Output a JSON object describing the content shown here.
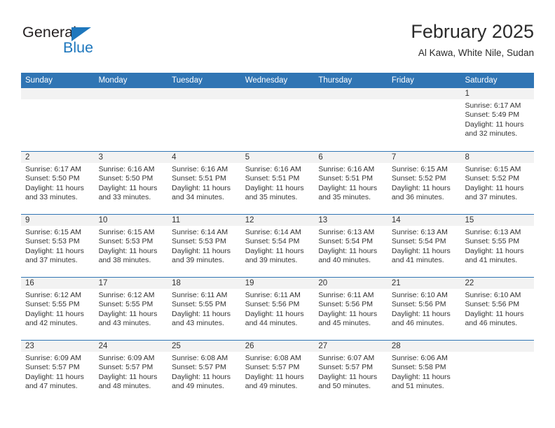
{
  "logo": {
    "word_one": "General",
    "word_two": "Blue",
    "triangle_color": "#1e77bd"
  },
  "header": {
    "title": "February 2025",
    "subtitle": "Al Kawa, White Nile, Sudan"
  },
  "theme": {
    "header_blue": "#3075b4",
    "day_band_gray": "#f2f2f2",
    "text": "#333333"
  },
  "weekdays": [
    "Sunday",
    "Monday",
    "Tuesday",
    "Wednesday",
    "Thursday",
    "Friday",
    "Saturday"
  ],
  "labels": {
    "sunrise_prefix": "Sunrise:",
    "sunset_prefix": "Sunset:",
    "daylight_prefix": "Daylight:"
  },
  "weeks": [
    [
      {
        "day": "",
        "sunrise": "",
        "sunset": "",
        "daylight": "",
        "empty": true
      },
      {
        "day": "",
        "sunrise": "",
        "sunset": "",
        "daylight": "",
        "empty": true
      },
      {
        "day": "",
        "sunrise": "",
        "sunset": "",
        "daylight": "",
        "empty": true
      },
      {
        "day": "",
        "sunrise": "",
        "sunset": "",
        "daylight": "",
        "empty": true
      },
      {
        "day": "",
        "sunrise": "",
        "sunset": "",
        "daylight": "",
        "empty": true
      },
      {
        "day": "",
        "sunrise": "",
        "sunset": "",
        "daylight": "",
        "empty": true
      },
      {
        "day": "1",
        "sunrise": "Sunrise: 6:17 AM",
        "sunset": "Sunset: 5:49 PM",
        "daylight": "Daylight: 11 hours and 32 minutes.",
        "empty": false
      }
    ],
    [
      {
        "day": "2",
        "sunrise": "Sunrise: 6:17 AM",
        "sunset": "Sunset: 5:50 PM",
        "daylight": "Daylight: 11 hours and 33 minutes.",
        "empty": false
      },
      {
        "day": "3",
        "sunrise": "Sunrise: 6:16 AM",
        "sunset": "Sunset: 5:50 PM",
        "daylight": "Daylight: 11 hours and 33 minutes.",
        "empty": false
      },
      {
        "day": "4",
        "sunrise": "Sunrise: 6:16 AM",
        "sunset": "Sunset: 5:51 PM",
        "daylight": "Daylight: 11 hours and 34 minutes.",
        "empty": false
      },
      {
        "day": "5",
        "sunrise": "Sunrise: 6:16 AM",
        "sunset": "Sunset: 5:51 PM",
        "daylight": "Daylight: 11 hours and 35 minutes.",
        "empty": false
      },
      {
        "day": "6",
        "sunrise": "Sunrise: 6:16 AM",
        "sunset": "Sunset: 5:51 PM",
        "daylight": "Daylight: 11 hours and 35 minutes.",
        "empty": false
      },
      {
        "day": "7",
        "sunrise": "Sunrise: 6:15 AM",
        "sunset": "Sunset: 5:52 PM",
        "daylight": "Daylight: 11 hours and 36 minutes.",
        "empty": false
      },
      {
        "day": "8",
        "sunrise": "Sunrise: 6:15 AM",
        "sunset": "Sunset: 5:52 PM",
        "daylight": "Daylight: 11 hours and 37 minutes.",
        "empty": false
      }
    ],
    [
      {
        "day": "9",
        "sunrise": "Sunrise: 6:15 AM",
        "sunset": "Sunset: 5:53 PM",
        "daylight": "Daylight: 11 hours and 37 minutes.",
        "empty": false
      },
      {
        "day": "10",
        "sunrise": "Sunrise: 6:15 AM",
        "sunset": "Sunset: 5:53 PM",
        "daylight": "Daylight: 11 hours and 38 minutes.",
        "empty": false
      },
      {
        "day": "11",
        "sunrise": "Sunrise: 6:14 AM",
        "sunset": "Sunset: 5:53 PM",
        "daylight": "Daylight: 11 hours and 39 minutes.",
        "empty": false
      },
      {
        "day": "12",
        "sunrise": "Sunrise: 6:14 AM",
        "sunset": "Sunset: 5:54 PM",
        "daylight": "Daylight: 11 hours and 39 minutes.",
        "empty": false
      },
      {
        "day": "13",
        "sunrise": "Sunrise: 6:13 AM",
        "sunset": "Sunset: 5:54 PM",
        "daylight": "Daylight: 11 hours and 40 minutes.",
        "empty": false
      },
      {
        "day": "14",
        "sunrise": "Sunrise: 6:13 AM",
        "sunset": "Sunset: 5:54 PM",
        "daylight": "Daylight: 11 hours and 41 minutes.",
        "empty": false
      },
      {
        "day": "15",
        "sunrise": "Sunrise: 6:13 AM",
        "sunset": "Sunset: 5:55 PM",
        "daylight": "Daylight: 11 hours and 41 minutes.",
        "empty": false
      }
    ],
    [
      {
        "day": "16",
        "sunrise": "Sunrise: 6:12 AM",
        "sunset": "Sunset: 5:55 PM",
        "daylight": "Daylight: 11 hours and 42 minutes.",
        "empty": false
      },
      {
        "day": "17",
        "sunrise": "Sunrise: 6:12 AM",
        "sunset": "Sunset: 5:55 PM",
        "daylight": "Daylight: 11 hours and 43 minutes.",
        "empty": false
      },
      {
        "day": "18",
        "sunrise": "Sunrise: 6:11 AM",
        "sunset": "Sunset: 5:55 PM",
        "daylight": "Daylight: 11 hours and 43 minutes.",
        "empty": false
      },
      {
        "day": "19",
        "sunrise": "Sunrise: 6:11 AM",
        "sunset": "Sunset: 5:56 PM",
        "daylight": "Daylight: 11 hours and 44 minutes.",
        "empty": false
      },
      {
        "day": "20",
        "sunrise": "Sunrise: 6:11 AM",
        "sunset": "Sunset: 5:56 PM",
        "daylight": "Daylight: 11 hours and 45 minutes.",
        "empty": false
      },
      {
        "day": "21",
        "sunrise": "Sunrise: 6:10 AM",
        "sunset": "Sunset: 5:56 PM",
        "daylight": "Daylight: 11 hours and 46 minutes.",
        "empty": false
      },
      {
        "day": "22",
        "sunrise": "Sunrise: 6:10 AM",
        "sunset": "Sunset: 5:56 PM",
        "daylight": "Daylight: 11 hours and 46 minutes.",
        "empty": false
      }
    ],
    [
      {
        "day": "23",
        "sunrise": "Sunrise: 6:09 AM",
        "sunset": "Sunset: 5:57 PM",
        "daylight": "Daylight: 11 hours and 47 minutes.",
        "empty": false
      },
      {
        "day": "24",
        "sunrise": "Sunrise: 6:09 AM",
        "sunset": "Sunset: 5:57 PM",
        "daylight": "Daylight: 11 hours and 48 minutes.",
        "empty": false
      },
      {
        "day": "25",
        "sunrise": "Sunrise: 6:08 AM",
        "sunset": "Sunset: 5:57 PM",
        "daylight": "Daylight: 11 hours and 49 minutes.",
        "empty": false
      },
      {
        "day": "26",
        "sunrise": "Sunrise: 6:08 AM",
        "sunset": "Sunset: 5:57 PM",
        "daylight": "Daylight: 11 hours and 49 minutes.",
        "empty": false
      },
      {
        "day": "27",
        "sunrise": "Sunrise: 6:07 AM",
        "sunset": "Sunset: 5:57 PM",
        "daylight": "Daylight: 11 hours and 50 minutes.",
        "empty": false
      },
      {
        "day": "28",
        "sunrise": "Sunrise: 6:06 AM",
        "sunset": "Sunset: 5:58 PM",
        "daylight": "Daylight: 11 hours and 51 minutes.",
        "empty": false
      },
      {
        "day": "",
        "sunrise": "",
        "sunset": "",
        "daylight": "",
        "empty": true
      }
    ]
  ]
}
